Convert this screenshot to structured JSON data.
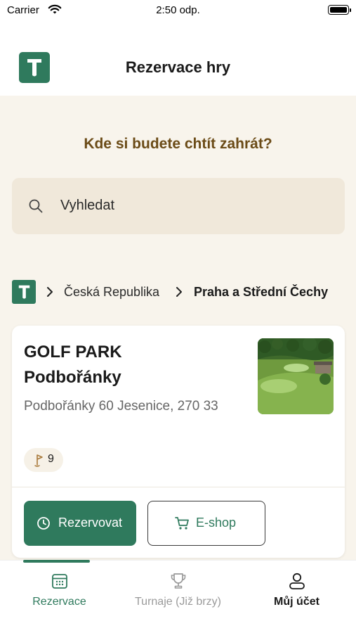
{
  "status_bar": {
    "carrier": "Carrier",
    "time": "2:50 odp."
  },
  "header": {
    "title": "Rezervace hry"
  },
  "main": {
    "question": "Kde si budete chtít zahrát?",
    "search": {
      "placeholder": "Vyhledat"
    }
  },
  "breadcrumb": {
    "items": [
      "Česká Republika",
      "Praha a Střední Čechy"
    ]
  },
  "course_card": {
    "name_line1": "GOLF PARK",
    "name_line2": "Podbořánky",
    "address": "Podbořánky 60 Jesenice, 270 33",
    "holes": "9",
    "reserve_label": "Rezervovat",
    "eshop_label": "E-shop"
  },
  "tabbar": {
    "tabs": [
      {
        "label": "Rezervace",
        "icon": "calendar-icon",
        "active": true
      },
      {
        "label": "Turnaje (Již brzy)",
        "icon": "trophy-icon",
        "active": false
      },
      {
        "label": "Můj účet",
        "icon": "user-icon",
        "active": false
      }
    ]
  },
  "colors": {
    "brand_green": "#2f7a5d",
    "heading_brown": "#6b4b17",
    "background": "#f8f4ec",
    "search_bg": "#f0e8da"
  }
}
